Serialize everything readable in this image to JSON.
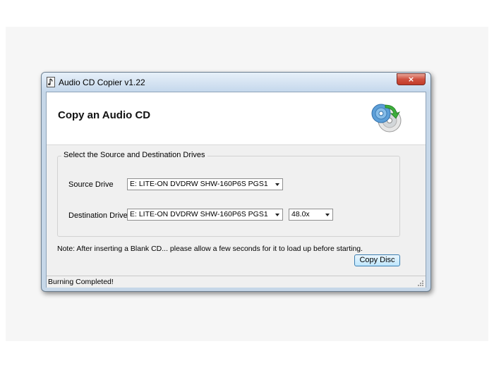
{
  "window": {
    "title": "Audio CD Copier v1.22",
    "close_glyph": "×"
  },
  "header": {
    "title": "Copy an Audio CD",
    "icon": "cd-copy-icon"
  },
  "group": {
    "legend": "Select the Source and Destination Drives",
    "source_label": "Source Drive",
    "source_value": "E: LITE-ON DVDRW SHW-160P6S PGS1",
    "destination_label": "Destination Drive",
    "destination_value": "E: LITE-ON DVDRW SHW-160P6S PGS1",
    "speed_value": "48.0x"
  },
  "note": "Note: After inserting a Blank CD... please allow a few seconds for it to load up before starting.",
  "actions": {
    "copy_label": "Copy Disc"
  },
  "status": {
    "text": "Burning Completed!"
  },
  "colors": {
    "close_red": "#c13a28",
    "button_blue": "#bee6fd",
    "frame_blue": "#c6d7e8"
  }
}
